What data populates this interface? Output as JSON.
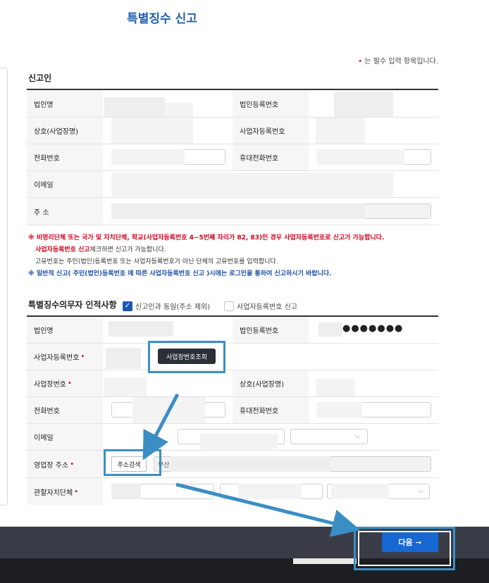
{
  "page": {
    "title": "특별징수 신고",
    "required_note": "는 필수 입력 항목입니다.",
    "required_mark": "•"
  },
  "reporter": {
    "section_title": "신고인",
    "labels": {
      "corp_name": "법인명",
      "corp_reg_no": "법인등록번호",
      "trade_name": "상호(사업장명)",
      "biz_reg_no": "사업자등록번호",
      "phone": "전화번호",
      "mobile": "휴대전화번호",
      "email": "이메일",
      "address": "주 소"
    }
  },
  "notices": {
    "line1": "※ 비영리단체 또는 국가 및 자치단체, 학교(사업자등록번호 4~5번째 자리가 82, 83)인 경우 사업자등록번호로 신고가 가능합니다.",
    "line2_strong": "사업자등록번호 신고",
    "line2_rest": "체크하면 신고가 가능합니다.",
    "line3": "고유번호는 주민(법인)등록번호 또는 사업자등록번호가 아닌 단체의 고유번호를 입력합니다.",
    "line4": "※ 일반적 신고( 주민(법인)등록번호 에 따른 사업자등록번호 신고 )시에는 로그인을 통하여 신고하시기 바랍니다."
  },
  "obligor": {
    "section_title": "특별징수의무자 인적사항",
    "checkbox_same": "신고인과 동일(주소 제외)",
    "checkbox_same_checked": true,
    "checkbox_biz": "사업자등록번호 신고",
    "checkbox_biz_checked": false,
    "labels": {
      "corp_name": "법인명",
      "corp_reg_no": "법인등록번호",
      "biz_reg_no": "사업자등록번호",
      "site_no": "사업장번호",
      "trade_name": "상호(사업장명)",
      "phone": "전화번호",
      "mobile": "휴대전화번호",
      "email": "이메일",
      "address": "영업장 주소",
      "jurisdiction": "관할자치단체"
    },
    "corp_reg_masked": "●●●●●●●",
    "lookup_button": "사업장번호조회",
    "address_search_button": "주소검색",
    "address_partial": "부산"
  },
  "footer": {
    "next_button": "다음 ➞"
  },
  "colors": {
    "title": "#1f5fae",
    "required": "#d0021b",
    "highlight": "#3b8ec4",
    "next": "#1667d2"
  }
}
